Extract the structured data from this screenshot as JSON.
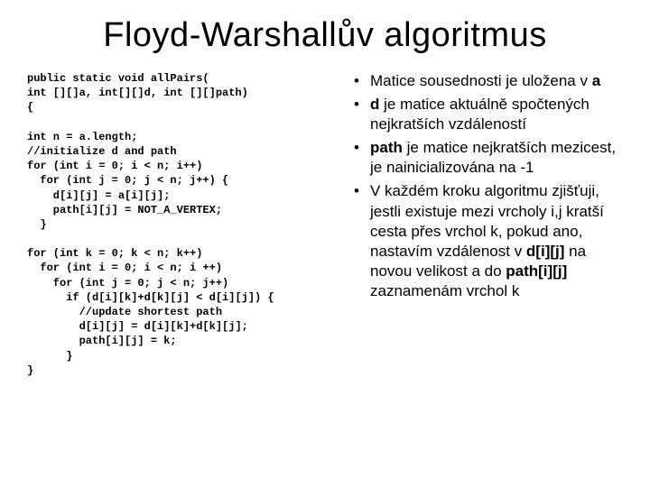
{
  "title": "Floyd-Warshallův algoritmus",
  "code": "public static void allPairs(\nint [][]a, int[][]d, int [][]path)\n{\n\nint n = a.length;\n//initialize d and path\nfor (int i = 0; i < n; i++)\n  for (int j = 0; j < n; j++) {\n    d[i][j] = a[i][j];\n    path[i][j] = NOT_A_VERTEX;\n  }\n\nfor (int k = 0; k < n; k++)\n  for (int i = 0; i < n; i ++)\n    for (int j = 0; j < n; j++)\n      if (d[i][k]+d[k][j] < d[i][j]) {\n        //update shortest path\n        d[i][j] = d[i][k]+d[k][j];\n        path[i][j] = k;\n      }\n}",
  "bullets": {
    "b1a": "Matice sousednosti je uložena v ",
    "b1b": "a",
    "b2a": "d",
    "b2b": " je matice aktuálně spočtených nejkratších vzdáleností",
    "b3a": "path",
    "b3b": " je matice nejkratších mezicest, je nainicializována na -1",
    "b4a": "V každém kroku algoritmu zjišťuji, jestli existuje mezi vrcholy i,j kratší cesta přes vrchol k, pokud ano, nastavím vzdálenost v ",
    "b4b": "d[i][j]",
    "b4c": " na novou velikost a do ",
    "b4d": "path[i][j]",
    "b4e": " zaznamenám vrchol k"
  }
}
